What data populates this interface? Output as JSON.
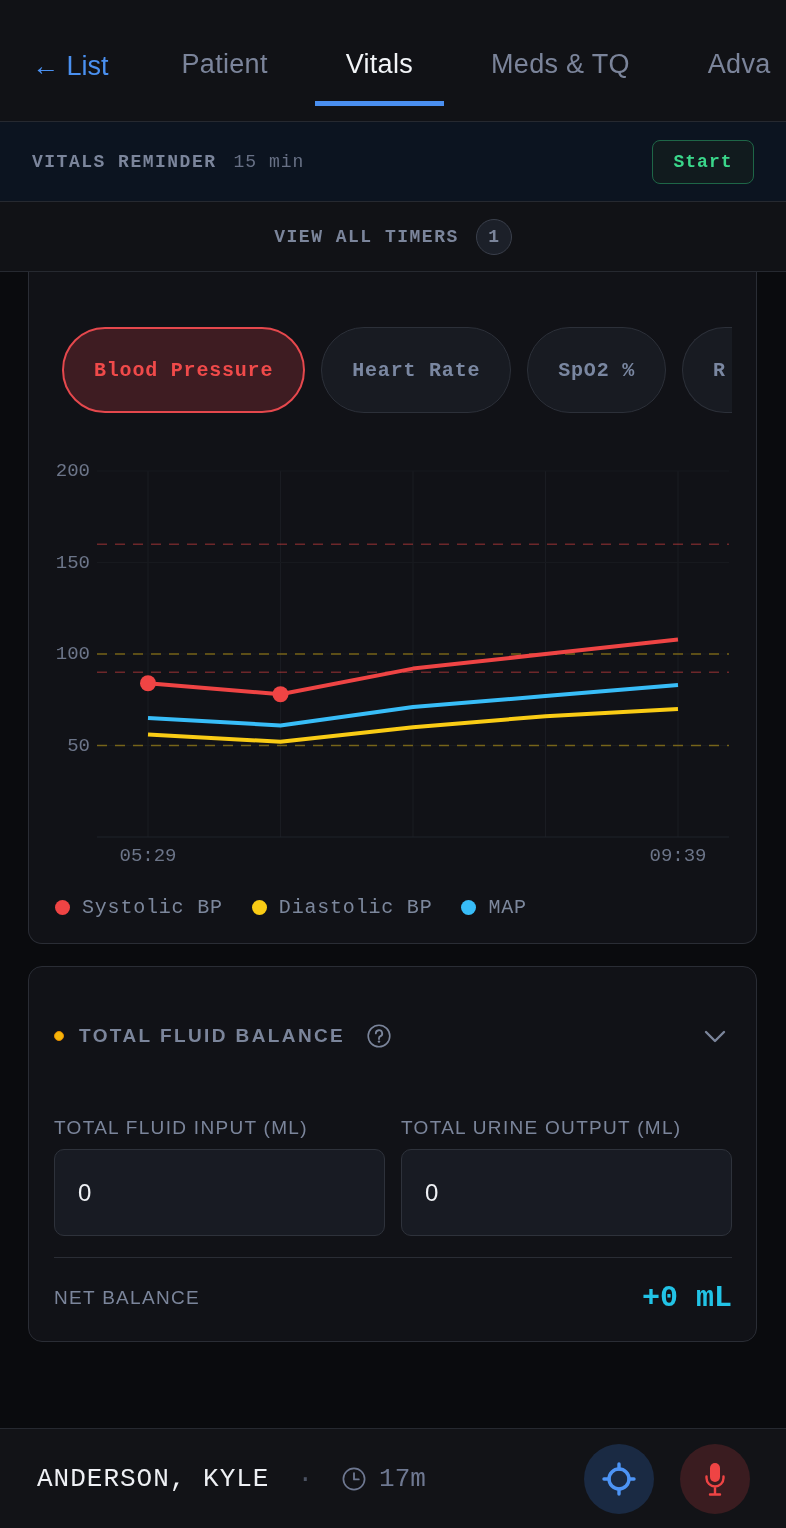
{
  "tabs": {
    "back_link": "← List",
    "items": [
      {
        "label": "Patient",
        "selected": false
      },
      {
        "label": "Vitals",
        "selected": true
      },
      {
        "label": "Meds & TQ",
        "selected": false
      },
      {
        "label": "Adva",
        "selected": false
      }
    ]
  },
  "reminder": {
    "title": "VITALS REMINDER",
    "interval": "15 min",
    "button": "Start"
  },
  "timers": {
    "label": "VIEW ALL TIMERS",
    "count": "1"
  },
  "vitals_chart": {
    "metrics": [
      {
        "label": "Blood Pressure",
        "selected": true
      },
      {
        "label": "Heart Rate",
        "selected": false
      },
      {
        "label": "SpO2 %",
        "selected": false
      },
      {
        "label": "R",
        "selected": false
      }
    ],
    "chart_data": {
      "type": "line",
      "categories": [
        "05:29",
        null,
        null,
        null,
        "09:39"
      ],
      "ylim": [
        0,
        200
      ],
      "yticks": [
        50,
        100,
        150,
        200
      ],
      "grid": true,
      "series": [
        {
          "name": "Systolic BP",
          "color": "#ef4444",
          "values": [
            84,
            78,
            92,
            100,
            108
          ]
        },
        {
          "name": "Diastolic BP",
          "color": "#facc15",
          "values": [
            56,
            52,
            60,
            66,
            70
          ]
        },
        {
          "name": "MAP",
          "color": "#38bdf8",
          "values": [
            65,
            61,
            71,
            77,
            83
          ]
        }
      ],
      "ref_lines": [
        {
          "axis": "y",
          "value": 160,
          "color": "#ef4444"
        },
        {
          "axis": "y",
          "value": 90,
          "color": "#ef4444"
        },
        {
          "axis": "y",
          "value": 100,
          "color": "#facc15"
        },
        {
          "axis": "y",
          "value": 50,
          "color": "#facc15"
        }
      ]
    }
  },
  "fluid_balance": {
    "title": "TOTAL FLUID BALANCE",
    "expanded": true,
    "fields": [
      {
        "label": "TOTAL FLUID INPUT (ML)",
        "value": "0"
      },
      {
        "label": "TOTAL URINE OUTPUT (ML)",
        "value": "0"
      }
    ],
    "net": {
      "label": "NET BALANCE",
      "value": "+0 mL"
    }
  },
  "status_bar": {
    "patient": "ANDERSON, KYLE",
    "separator": "·",
    "elapsed": "17m",
    "buttons": [
      {
        "kind": "locate"
      },
      {
        "kind": "microphone"
      }
    ]
  }
}
